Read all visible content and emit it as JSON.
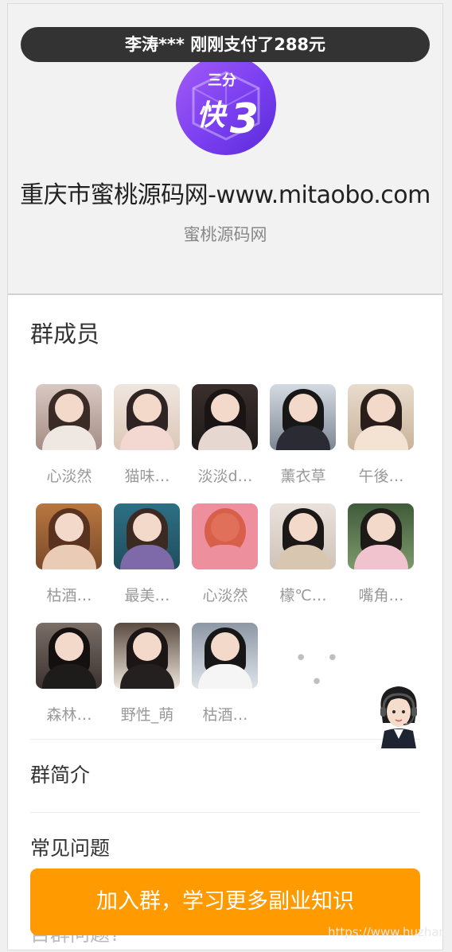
{
  "ticker": {
    "text": "李涛*** 刚刚支付了288元"
  },
  "logo": {
    "top_text": "三分",
    "main_text": "快",
    "numeral": "3"
  },
  "shop": {
    "title": "重庆市蜜桃源码网-www.mitaobo.com",
    "subtitle": "蜜桃源码网"
  },
  "members": {
    "title": "群成员",
    "more": "• • •",
    "items": [
      {
        "name": "心淡然"
      },
      {
        "name": "猫味…"
      },
      {
        "name": "淡淡d…"
      },
      {
        "name": "薰衣草"
      },
      {
        "name": "午後…"
      },
      {
        "name": "枯酒…"
      },
      {
        "name": "最美…"
      },
      {
        "name": "心淡然"
      },
      {
        "name": "檬℃…"
      },
      {
        "name": "嘴角…"
      },
      {
        "name": "森林…"
      },
      {
        "name": "野性_萌"
      },
      {
        "name": "枯酒…"
      }
    ]
  },
  "sections": {
    "intro": "群简介",
    "faq": "常见问题",
    "faq_cutoff": "目群问题?"
  },
  "cta": {
    "label": "加入群，学习更多副业知识"
  },
  "watermark": "https://www.huzhan.com",
  "colors": {
    "accent": "#ff9a00",
    "ticker_bg": "#333333",
    "logo_purple": "#7a3ff0"
  }
}
